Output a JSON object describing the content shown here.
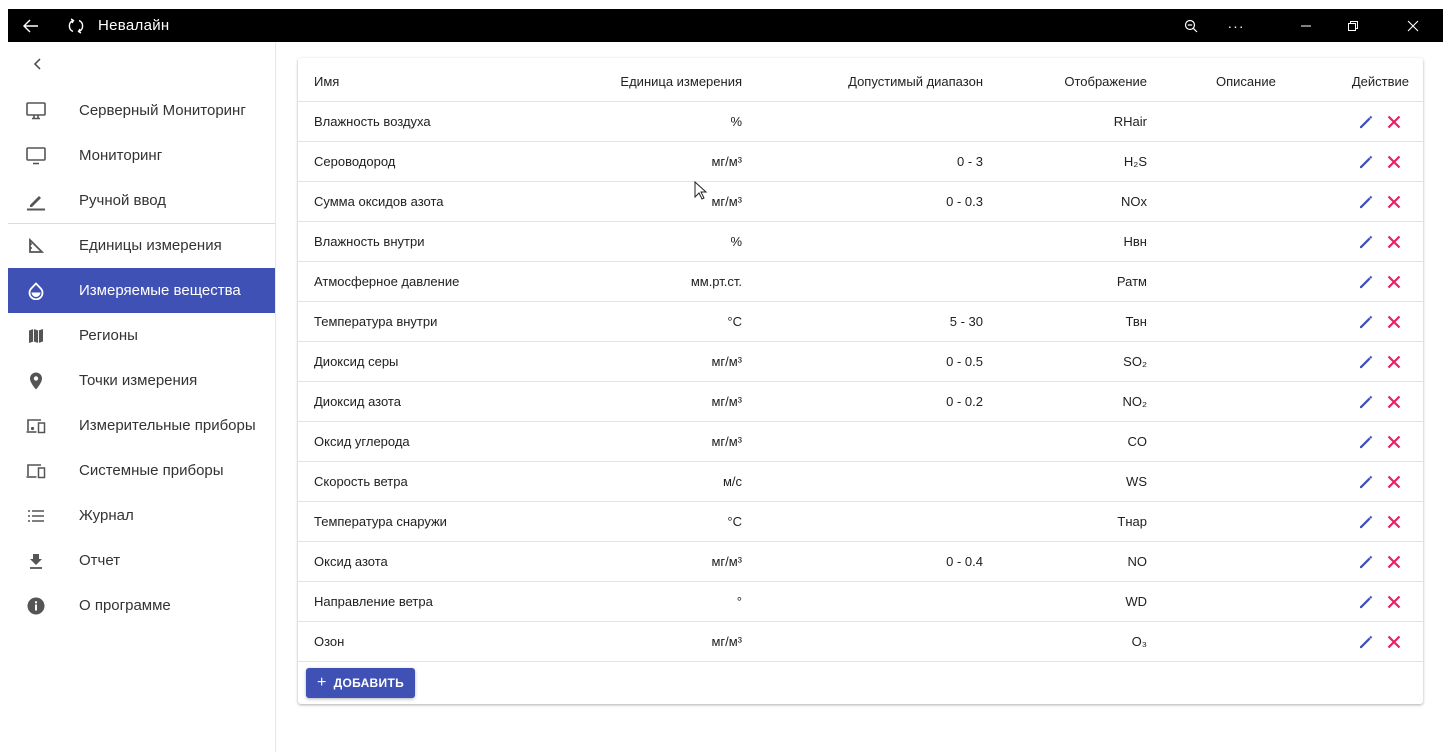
{
  "titlebar": {
    "title": "Невалайн",
    "back_icon": "arrow-left-icon",
    "refresh_icon": "refresh-icon",
    "zoom_icon": "zoom-out-icon",
    "more_icon": "ellipsis-icon",
    "minimize_icon": "minimize-icon",
    "restore_icon": "restore-icon",
    "close_icon": "close-icon"
  },
  "sidebar": {
    "collapse_icon": "chevron-left-icon",
    "items": [
      {
        "label": "Серверный Мониторинг",
        "icon": "desktop-icon"
      },
      {
        "label": "Мониторинг",
        "icon": "monitor-icon"
      },
      {
        "label": "Ручной ввод",
        "icon": "pencil-icon"
      },
      {
        "label": "Единицы измерения",
        "icon": "ruler-triangle-icon"
      },
      {
        "label": "Измеряемые вещества",
        "icon": "drop-icon",
        "active": true
      },
      {
        "label": "Регионы",
        "icon": "map-icon"
      },
      {
        "label": "Точки измерения",
        "icon": "map-pin-icon"
      },
      {
        "label": "Измерительные приборы",
        "icon": "devices-icon"
      },
      {
        "label": "Системные приборы",
        "icon": "computer-devices-icon"
      },
      {
        "label": "Журнал",
        "icon": "list-icon"
      },
      {
        "label": "Отчет",
        "icon": "download-icon"
      },
      {
        "label": "О программе",
        "icon": "info-icon"
      }
    ]
  },
  "table": {
    "headers": {
      "name": "Имя",
      "unit": "Единица измерения",
      "range": "Допустимый диапазон",
      "display": "Отображение",
      "description": "Описание",
      "action": "Действие"
    },
    "rows": [
      {
        "name": "Влажность воздуха",
        "unit": "%",
        "range": "",
        "display": "RHair",
        "description": ""
      },
      {
        "name": "Сероводород",
        "unit": "мг/м³",
        "range": "0 - 3",
        "display": "H₂S",
        "description": ""
      },
      {
        "name": "Сумма оксидов азота",
        "unit": "мг/м³",
        "range": "0 - 0.3",
        "display": "NOx",
        "description": ""
      },
      {
        "name": "Влажность внутри",
        "unit": "%",
        "range": "",
        "display": "Нвн",
        "description": ""
      },
      {
        "name": "Атмосферное давление",
        "unit": "мм.рт.ст.",
        "range": "",
        "display": "Ратм",
        "description": ""
      },
      {
        "name": "Температура внутри",
        "unit": "°C",
        "range": "5 - 30",
        "display": "Твн",
        "description": ""
      },
      {
        "name": "Диоксид серы",
        "unit": "мг/м³",
        "range": "0 - 0.5",
        "display": "SO₂",
        "description": ""
      },
      {
        "name": "Диоксид азота",
        "unit": "мг/м³",
        "range": "0 - 0.2",
        "display": "NO₂",
        "description": ""
      },
      {
        "name": "Оксид углерода",
        "unit": "мг/м³",
        "range": "",
        "display": "CO",
        "description": ""
      },
      {
        "name": "Скорость ветра",
        "unit": "м/с",
        "range": "",
        "display": "WS",
        "description": ""
      },
      {
        "name": "Температура снаружи",
        "unit": "°C",
        "range": "",
        "display": "Тнар",
        "description": ""
      },
      {
        "name": "Оксид азота",
        "unit": "мг/м³",
        "range": "0 - 0.4",
        "display": "NO",
        "description": ""
      },
      {
        "name": "Направление ветра",
        "unit": "°",
        "range": "",
        "display": "WD",
        "description": ""
      },
      {
        "name": "Озон",
        "unit": "мг/м³",
        "range": "",
        "display": "O₃",
        "description": ""
      }
    ],
    "edit_icon": "pencil-icon",
    "delete_icon": "close-icon",
    "edit_color": "#3f51b5",
    "delete_color": "#e91e63"
  },
  "add_button": {
    "label": "ДОБАВИТЬ",
    "icon": "plus-icon"
  },
  "colors": {
    "accent": "#3f51b5",
    "titlebar": "#000000"
  }
}
